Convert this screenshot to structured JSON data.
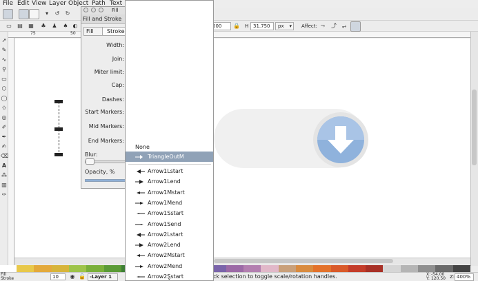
{
  "menubar": [
    "File",
    "Edit",
    "View",
    "Layer",
    "Object",
    "Path",
    "Text"
  ],
  "toolbar": {
    "h_label": "H",
    "h_value": "31.750",
    "w_value_partial": "000",
    "unit": "px",
    "affect_label": "Affect:"
  },
  "dialog": {
    "title": "Fill and Stroke",
    "title_partial": "Fill",
    "tab_fill": "Fill",
    "tab_stroke": "Stroke",
    "labels": {
      "width": "Width:",
      "join": "Join:",
      "miter": "Miter limit:",
      "cap": "Cap:",
      "dashes": "Dashes:",
      "start_markers": "Start Markers:",
      "mid_markers": "Mid Markers:",
      "end_markers": "End Markers:"
    },
    "blur_label": "Blur:",
    "opacity_label": "Opacity, %"
  },
  "marker_menu": {
    "none_label": "None",
    "selected": "TriangleOutM",
    "items": [
      "Arrow1Lstart",
      "Arrow1Lend",
      "Arrow1Mstart",
      "Arrow1Mend",
      "Arrow1Sstart",
      "Arrow1Send",
      "Arrow2Lstart",
      "Arrow2Lend",
      "Arrow2Mstart",
      "Arrow2Mend",
      "Arrow2Sstart"
    ]
  },
  "ruler": {
    "h_ticks": [
      "75",
      "50"
    ]
  },
  "statusbar": {
    "fill_label": "Fill",
    "stroke_label": "Stroke",
    "opacity_value": "10",
    "layer": "-Layer 1",
    "message": "ck selection to toggle scale/rotation handles.",
    "x_label": "X:",
    "x_value": "-54.00",
    "y_label": "Y:",
    "y_value": "120.50",
    "z_label": "Z:",
    "zoom": "400%"
  },
  "palette_colors": [
    "#e8c84a",
    "#e3a93b",
    "#d7b43a",
    "#9ec44a",
    "#7ab03a",
    "#5a9a36",
    "#3e7f36",
    "#2f8e83",
    "#4aa7b5",
    "#3c84b8",
    "#4f6fae",
    "#7a64aa",
    "#9c6aa6",
    "#b37fb0",
    "#e1b8c9",
    "#c9a07a",
    "#d98b3f",
    "#e3722b",
    "#d95a2a",
    "#c43d2a",
    "#a83127",
    "#d6d6d6",
    "#b5b5b5",
    "#8f8f8f",
    "#6a6a6a",
    "#444444"
  ],
  "colors": {
    "selection": "#90a2b7",
    "icon_blue": "#8fb2dc",
    "icon_ring": "#e4e4e4"
  }
}
